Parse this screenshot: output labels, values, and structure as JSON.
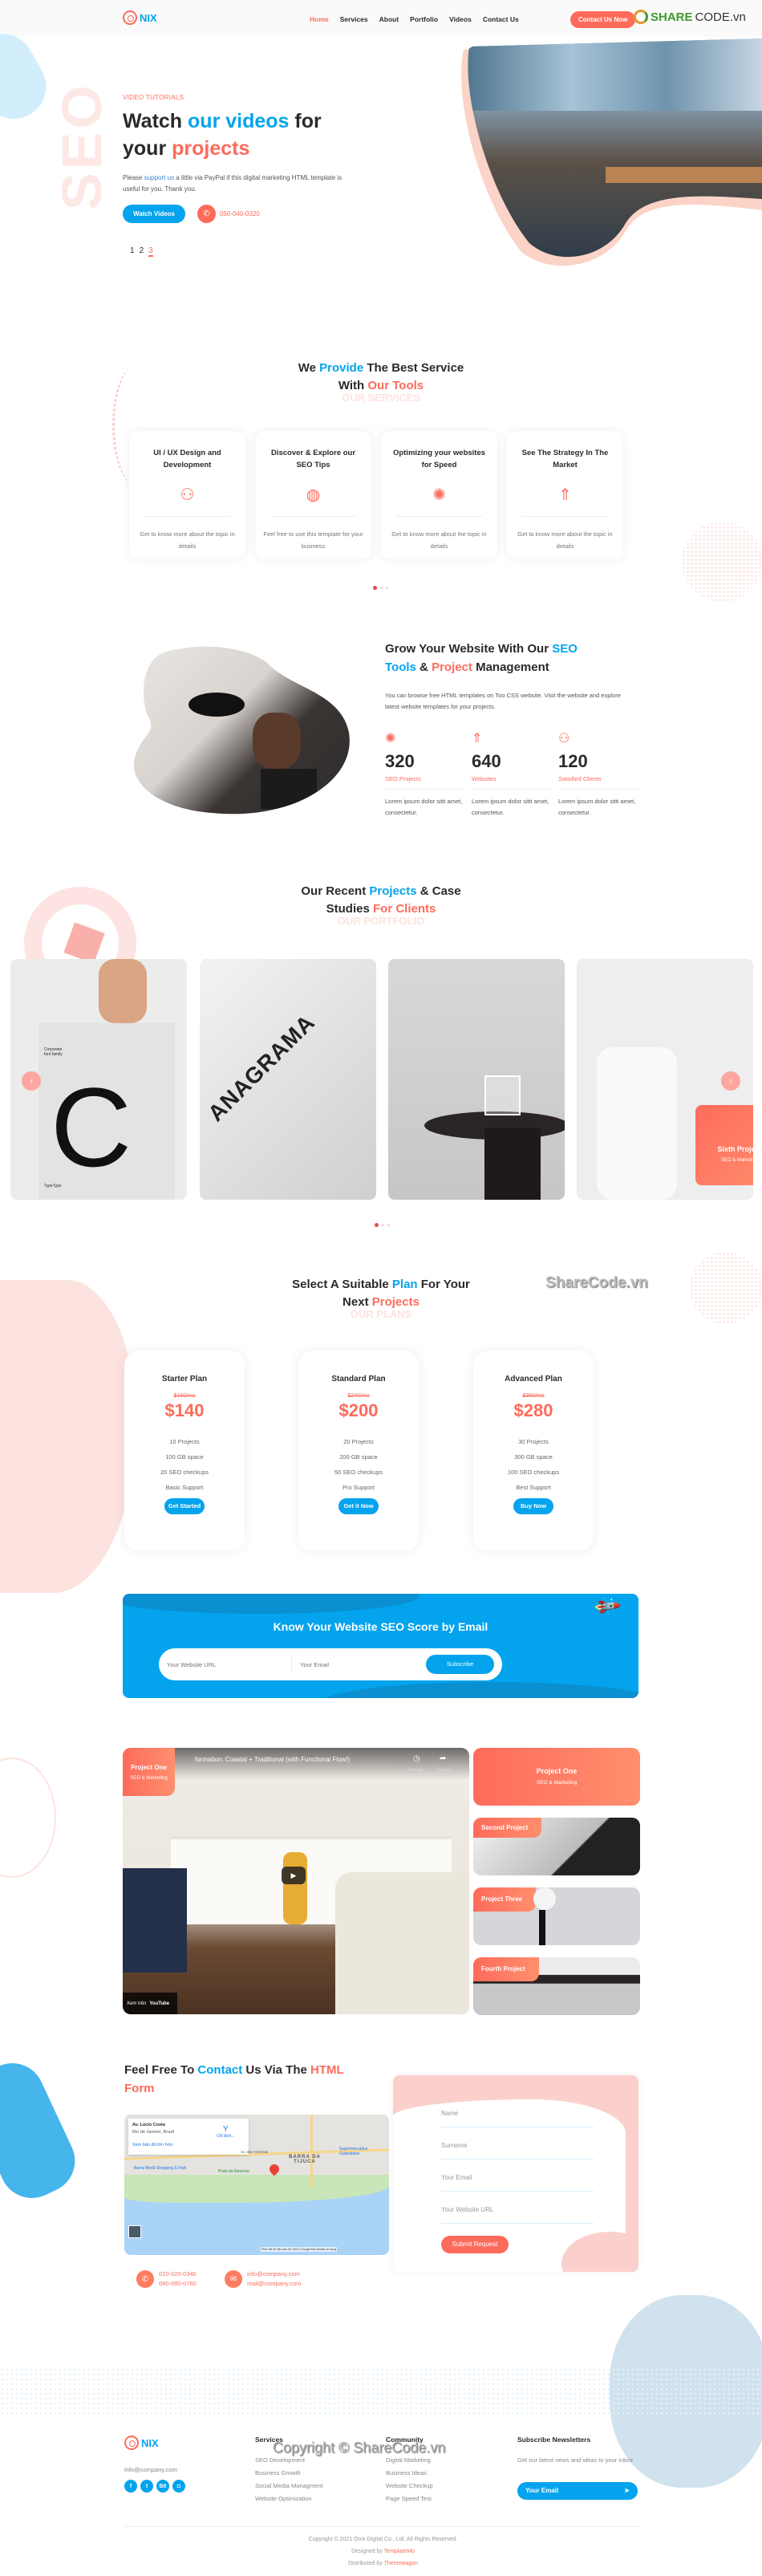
{
  "header": {
    "logo_text": "NIX",
    "nav": [
      {
        "label": "Home",
        "active": true
      },
      {
        "label": "Services"
      },
      {
        "label": "About"
      },
      {
        "label": "Portfolio"
      },
      {
        "label": "Videos"
      },
      {
        "label": "Contact Us"
      }
    ],
    "cta_label": "Contact Us Now",
    "watermark_brand": "SHARE",
    "watermark_rest": "CODE.vn"
  },
  "hero": {
    "vertical_text": "SEO",
    "eyebrow": "VIDEO TUTORIALS",
    "title_1": "Watch ",
    "title_2": "our videos",
    "title_3": " for",
    "title_4": "your ",
    "title_5": "projects",
    "para_1": "Please ",
    "para_link": "support us",
    "para_2": " a little via PayPal if this digital marketing HTML template is useful for you. Thank you.",
    "button": "Watch Videos",
    "phone": "050-040-0320",
    "pages": [
      "1",
      "2",
      "3"
    ],
    "active_page": "3"
  },
  "services": {
    "title_1": "We ",
    "title_2": "Provide",
    "title_3": " The Best Service",
    "title_4": "With ",
    "title_5": "Our Tools",
    "subtitle": "OUR SERVICES",
    "cards": [
      {
        "title": "UI / UX Design and Development",
        "icon": "chart-money-icon",
        "text": "Get to know more about the topic in details"
      },
      {
        "title": "Discover & Explore our SEO Tips",
        "icon": "globe-people-icon",
        "text": "Feel free to use this template for your business"
      },
      {
        "title": "Optimizing your websites for Speed",
        "icon": "gift-box-icon",
        "text": "Get to know more about the topic in details"
      },
      {
        "title": "See The Strategy In The Market",
        "icon": "rocket-icon",
        "text": "Get to know more about the topic in details"
      }
    ]
  },
  "about": {
    "title_1": "Grow Your Website With Our ",
    "title_2": "SEO",
    "title_3": "Tools",
    "title_4": " & ",
    "title_5": "Project",
    "title_6": " Management",
    "paragraph": "You can browse free HTML templates on Too CSS website. Visit the website and explore latest website templates for your projects.",
    "stats": [
      {
        "icon": "gift-box-icon",
        "value": "320",
        "label": "SEO Projects",
        "text": "Lorem ipsum dolor sitti amet, consectetur."
      },
      {
        "icon": "rocket-icon",
        "value": "640",
        "label": "Websites",
        "text": "Lorem ipsum dolor sitti amet, consectetur."
      },
      {
        "icon": "chart-money-icon",
        "value": "120",
        "label": "Satisfied Clients",
        "text": "Lorem ipsum dolor sitti amet, consectetur."
      }
    ]
  },
  "portfolio": {
    "title_1": "Our Recent ",
    "title_2": "Projects",
    "title_3": " & Case",
    "title_4": "Studies ",
    "title_5": "For Clients",
    "subtitle": "OUR PORTFOLIO",
    "card1_text": "C",
    "card1_caption": "Corporate font family",
    "card1_brand": "TypeType",
    "card2_text": "ANAGRAMA",
    "overlay_title": "Sixth Project",
    "overlay_sub": "SEO & Marketing"
  },
  "pricing": {
    "title_1": "Select A Suitable ",
    "title_2": "Plan",
    "title_3": " For Your",
    "title_4": "Next ",
    "title_5": "Projects",
    "subtitle": "OUR PLANS",
    "watermark": "ShareCode.vn",
    "plans": [
      {
        "name": "Starter Plan",
        "old_price": "$160/mo",
        "price": "$140",
        "features": [
          "10 Projects",
          "100 GB space",
          "20 SEO checkups",
          "Basic Support"
        ],
        "button": "Get Started"
      },
      {
        "name": "Standard Plan",
        "old_price": "$240/mo",
        "price": "$200",
        "features": [
          "20 Projects",
          "200 GB space",
          "50 SEO checkups",
          "Pro Support"
        ],
        "button": "Get it Now"
      },
      {
        "name": "Advanced Plan",
        "old_price": "$360/mo",
        "price": "$280",
        "features": [
          "30 Projects",
          "300 GB space",
          "100 SEO checkups",
          "Best Support"
        ],
        "button": "Buy Now"
      }
    ]
  },
  "seo_banner": {
    "title": "Know Your Website SEO Score by Email",
    "url_placeholder": "Your Website URL",
    "email_placeholder": "Your Email",
    "button": "Subscribe"
  },
  "videos": {
    "video_title": "formation: Coastal + Traditional (with Functional Flow!)",
    "watch_later": "Xem sau",
    "share": "Chia sẻ",
    "watch_on": "Xem trên",
    "youtube": "YouTube",
    "main_tag_title": "Project One",
    "main_tag_sub": "SEO & Marketing",
    "side": [
      {
        "title": "Project One",
        "sub": "SEO & Marketing"
      },
      {
        "title": "Second Project"
      },
      {
        "title": "Project Three"
      },
      {
        "title": "Fourth Project"
      }
    ]
  },
  "contact": {
    "title_1": "Feel Free To ",
    "title_2": "Contact",
    "title_3": " Us Via The ",
    "title_4": "HTML",
    "title_5": "Form",
    "map": {
      "place": "Av. Lúcio Costa",
      "city": "Rio de Janeiro, Brazil",
      "directions": "Chỉ đườ...",
      "larger_map": "Xem bản đồ lớn hơn",
      "area": "BARRA DA TIJUCA",
      "poi_1": "Barra World Shopping & Park",
      "poi_2": "Praia da Reserva",
      "poi_3": "Supermercados Guanabara",
      "road": "Av. das Américas",
      "footer": "Phím tắt   Dữ liệu bản đồ ©2021 Google   Điều khoản sử dụng"
    },
    "form": {
      "name": "Name",
      "surname": "Surname",
      "email": "Your Email",
      "website": "Your Website URL",
      "submit": "Submit Request"
    },
    "phones": [
      "010-020-0340",
      "090-080-0760"
    ],
    "emails": [
      "info@company.com",
      "mail@company.com"
    ]
  },
  "footer": {
    "logo_text": "NIX",
    "email": "info@company.com",
    "social": [
      "f",
      "t",
      "Bē",
      "◘"
    ],
    "services_title": "Services",
    "services": [
      "SEO Development",
      "Business Growth",
      "Social Media Managment",
      "Website Optimization"
    ],
    "community_title": "Community",
    "community": [
      "Digital Marketing",
      "Business Ideas",
      "Website Checkup",
      "Page Speed Test"
    ],
    "news_title": "Subscribe Newsletters",
    "news_text": "Get our latest news and ideas to your inbox",
    "news_placeholder": "Your Email",
    "watermark": "Copyright © ShareCode.vn",
    "copyright": "Copyright © 2021 Onix Digital Co., Ltd. All Rights Reserved.",
    "designed_by": "Designed by ",
    "designed_link": "TemplateMo",
    "distributed_by": "Distributed by ",
    "distributed_link": "Themewagon"
  }
}
